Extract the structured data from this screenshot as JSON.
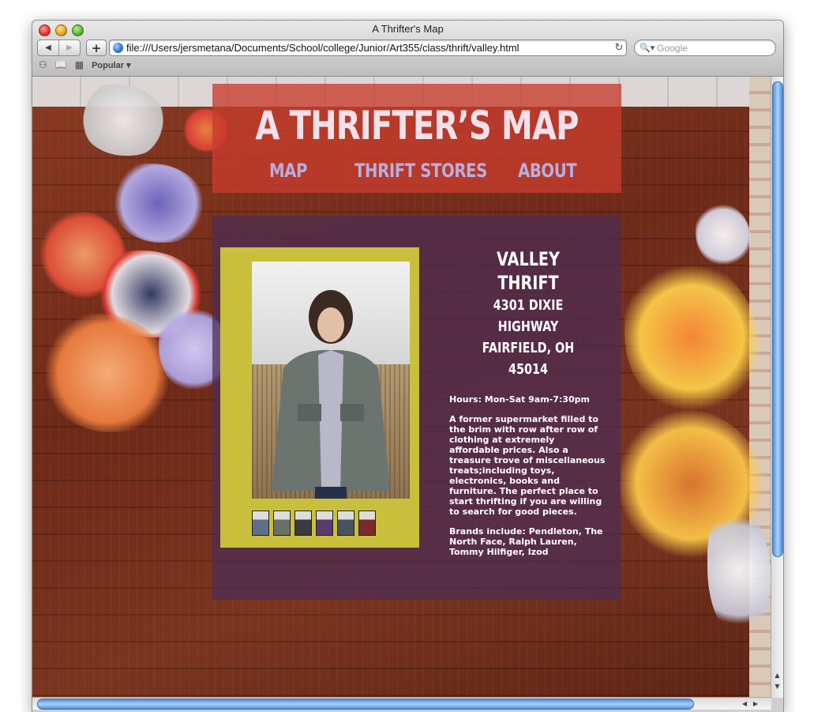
{
  "window": {
    "title": "A Thrifter's Map"
  },
  "toolbar": {
    "back_icon": "◀",
    "forward_icon": "▶",
    "add_icon": "+",
    "url": "file:///Users/jersmetana/Documents/School/college/Junior/Art355/class/thrift/valley.html",
    "reload_icon": "↻",
    "search_icon": "🔍▾",
    "search_placeholder": "Google"
  },
  "bookmarks": {
    "reader_icon": "⚇",
    "book_icon": "📖",
    "grid_icon": "▦",
    "popular_label": "Popular ▾"
  },
  "site": {
    "title": "A THRIFTER’S MAP",
    "nav": [
      {
        "label": "MAP"
      },
      {
        "label": "THRIFT STORES"
      },
      {
        "label": "ABOUT"
      }
    ]
  },
  "store": {
    "name": "VALLEY THRIFT",
    "address_line1": "4301 DIXIE HIGHWAY",
    "address_line2": "FAIRFIELD, OH 45014",
    "hours": "Hours: Mon-Sat 9am-7:30pm",
    "description": "A former supermarket filled to the brim with row after row of clothing at extremely affordable prices. Also a treasure trove of miscellaneous treats;including toys, electronics, books and furniture. The perfect place to start thrifting if you are willing to search for good pieces.",
    "brands": "Brands include: Pendleton, The North Face, Ralph Lauren, Tommy Hilfiger, Izod"
  },
  "colors": {
    "header_bg": "#c83c2d",
    "panel_bg": "#4b2d55",
    "frame": "#c8c03c",
    "title_text": "#f1e1ea",
    "nav_text": "#b7aee0"
  },
  "thumbnails": [
    "#5d7088",
    "#6b7068",
    "#3b3a40",
    "#5a3a6a",
    "#4a5260",
    "#7a2a2a"
  ]
}
